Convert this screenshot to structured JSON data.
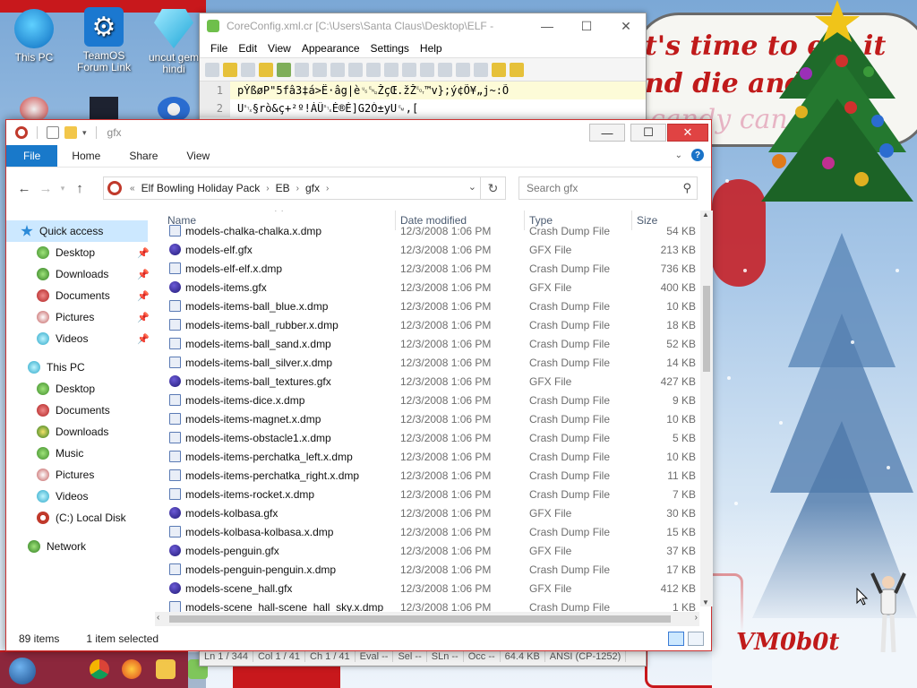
{
  "desktop": {
    "icons": [
      {
        "label": "This PC"
      },
      {
        "label": "TeamOS Forum Link"
      },
      {
        "label": "uncut gem hindi"
      }
    ],
    "speech_lines": [
      "t's time to eat it",
      "nd die and co",
      "candy can"
    ],
    "signature": "VM0b0t"
  },
  "notepad": {
    "title": "CoreConfig.xml.cr [C:\\Users\\Santa Claus\\Desktop\\ELF -",
    "menu": [
      "File",
      "Edit",
      "View",
      "Appearance",
      "Settings",
      "Help"
    ],
    "lines": [
      {
        "num": "1",
        "text": "pÝßøP\"5fâ3‡á>Ë·âg|è␟␅ŽçŒ.žŽ␄™v};ý¢Õ¥„j~:Õ"
      },
      {
        "num": "2",
        "text": "U␂§rò&ç+²º!ÁÛ␂É®É]G2Ó±yU␙,["
      }
    ],
    "status": [
      "Ln 1 / 344",
      "Col 1 / 41",
      "Ch 1 / 41",
      "Eval --",
      "Sel --",
      "SLn --",
      "Occ --",
      "64.4 KB",
      "ANSI (CP-1252)"
    ]
  },
  "explorer": {
    "title": "gfx",
    "tabs": {
      "file": "File",
      "home": "Home",
      "share": "Share",
      "view": "View"
    },
    "breadcrumb": [
      "Elf Bowling Holiday Pack",
      "EB",
      "gfx"
    ],
    "search_placeholder": "Search gfx",
    "nav": {
      "quick_access": "Quick access",
      "qa_items": [
        "Desktop",
        "Downloads",
        "Documents",
        "Pictures",
        "Videos"
      ],
      "this_pc": "This PC",
      "pc_items": [
        "Desktop",
        "Documents",
        "Downloads",
        "Music",
        "Pictures",
        "Videos",
        "(C:) Local Disk"
      ],
      "network": "Network"
    },
    "columns": {
      "name": "Name",
      "date": "Date modified",
      "type": "Type",
      "size": "Size"
    },
    "files": [
      {
        "name": "models-chalka-chalka.x.dmp",
        "date": "12/3/2008 1:06 PM",
        "type": "Crash Dump File",
        "size": "54 KB",
        "kind": "dmp"
      },
      {
        "name": "models-elf.gfx",
        "date": "12/3/2008 1:06 PM",
        "type": "GFX File",
        "size": "213 KB",
        "kind": "gfx"
      },
      {
        "name": "models-elf-elf.x.dmp",
        "date": "12/3/2008 1:06 PM",
        "type": "Crash Dump File",
        "size": "736 KB",
        "kind": "dmp"
      },
      {
        "name": "models-items.gfx",
        "date": "12/3/2008 1:06 PM",
        "type": "GFX File",
        "size": "400 KB",
        "kind": "gfx"
      },
      {
        "name": "models-items-ball_blue.x.dmp",
        "date": "12/3/2008 1:06 PM",
        "type": "Crash Dump File",
        "size": "10 KB",
        "kind": "dmp"
      },
      {
        "name": "models-items-ball_rubber.x.dmp",
        "date": "12/3/2008 1:06 PM",
        "type": "Crash Dump File",
        "size": "18 KB",
        "kind": "dmp"
      },
      {
        "name": "models-items-ball_sand.x.dmp",
        "date": "12/3/2008 1:06 PM",
        "type": "Crash Dump File",
        "size": "52 KB",
        "kind": "dmp"
      },
      {
        "name": "models-items-ball_silver.x.dmp",
        "date": "12/3/2008 1:06 PM",
        "type": "Crash Dump File",
        "size": "14 KB",
        "kind": "dmp"
      },
      {
        "name": "models-items-ball_textures.gfx",
        "date": "12/3/2008 1:06 PM",
        "type": "GFX File",
        "size": "427 KB",
        "kind": "gfx"
      },
      {
        "name": "models-items-dice.x.dmp",
        "date": "12/3/2008 1:06 PM",
        "type": "Crash Dump File",
        "size": "9 KB",
        "kind": "dmp"
      },
      {
        "name": "models-items-magnet.x.dmp",
        "date": "12/3/2008 1:06 PM",
        "type": "Crash Dump File",
        "size": "10 KB",
        "kind": "dmp"
      },
      {
        "name": "models-items-obstacle1.x.dmp",
        "date": "12/3/2008 1:06 PM",
        "type": "Crash Dump File",
        "size": "5 KB",
        "kind": "dmp"
      },
      {
        "name": "models-items-perchatka_left.x.dmp",
        "date": "12/3/2008 1:06 PM",
        "type": "Crash Dump File",
        "size": "10 KB",
        "kind": "dmp"
      },
      {
        "name": "models-items-perchatka_right.x.dmp",
        "date": "12/3/2008 1:06 PM",
        "type": "Crash Dump File",
        "size": "11 KB",
        "kind": "dmp"
      },
      {
        "name": "models-items-rocket.x.dmp",
        "date": "12/3/2008 1:06 PM",
        "type": "Crash Dump File",
        "size": "7 KB",
        "kind": "dmp"
      },
      {
        "name": "models-kolbasa.gfx",
        "date": "12/3/2008 1:06 PM",
        "type": "GFX File",
        "size": "30 KB",
        "kind": "gfx"
      },
      {
        "name": "models-kolbasa-kolbasa.x.dmp",
        "date": "12/3/2008 1:06 PM",
        "type": "Crash Dump File",
        "size": "15 KB",
        "kind": "dmp"
      },
      {
        "name": "models-penguin.gfx",
        "date": "12/3/2008 1:06 PM",
        "type": "GFX File",
        "size": "37 KB",
        "kind": "gfx"
      },
      {
        "name": "models-penguin-penguin.x.dmp",
        "date": "12/3/2008 1:06 PM",
        "type": "Crash Dump File",
        "size": "17 KB",
        "kind": "dmp"
      },
      {
        "name": "models-scene_hall.gfx",
        "date": "12/3/2008 1:06 PM",
        "type": "GFX File",
        "size": "412 KB",
        "kind": "gfx"
      },
      {
        "name": "models-scene_hall-scene_hall_sky.x.dmp",
        "date": "12/3/2008 1:06 PM",
        "type": "Crash Dump File",
        "size": "1 KB",
        "kind": "dmp"
      }
    ],
    "status": {
      "count": "89 items",
      "selected": "1 item selected"
    }
  }
}
